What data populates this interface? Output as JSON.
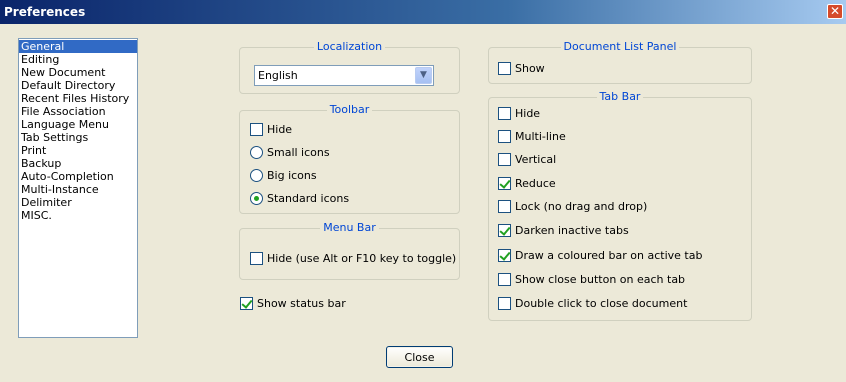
{
  "window": {
    "title": "Preferences",
    "close_glyph": "✕"
  },
  "categories": [
    {
      "label": "General",
      "selected": true
    },
    {
      "label": "Editing"
    },
    {
      "label": "New Document"
    },
    {
      "label": "Default Directory"
    },
    {
      "label": "Recent Files History"
    },
    {
      "label": "File Association"
    },
    {
      "label": "Language Menu"
    },
    {
      "label": "Tab Settings"
    },
    {
      "label": "Print"
    },
    {
      "label": "Backup"
    },
    {
      "label": "Auto-Completion"
    },
    {
      "label": "Multi-Instance"
    },
    {
      "label": "Delimiter"
    },
    {
      "label": "MISC."
    }
  ],
  "localization": {
    "title": "Localization",
    "language": "English"
  },
  "toolbar": {
    "title": "Toolbar",
    "hide": {
      "label": "Hide",
      "checked": false
    },
    "small_icons": {
      "label": "Small icons",
      "checked": false
    },
    "big_icons": {
      "label": "Big icons",
      "checked": false
    },
    "standard_icons": {
      "label": "Standard icons",
      "checked": true
    }
  },
  "menu_bar": {
    "title": "Menu Bar",
    "hide": {
      "label": "Hide (use Alt or F10 key to toggle)",
      "checked": false
    }
  },
  "status_bar": {
    "label": "Show status bar",
    "checked": true
  },
  "doc_list_panel": {
    "title": "Document List Panel",
    "show": {
      "label": "Show",
      "checked": false
    }
  },
  "tab_bar": {
    "title": "Tab Bar",
    "hide": {
      "label": "Hide",
      "checked": false
    },
    "multi_line": {
      "label": "Multi-line",
      "checked": false
    },
    "vertical": {
      "label": "Vertical",
      "checked": false
    },
    "reduce": {
      "label": "Reduce",
      "checked": true
    },
    "lock": {
      "label": "Lock (no drag and drop)",
      "checked": false
    },
    "darken": {
      "label": "Darken inactive tabs",
      "checked": true
    },
    "coloured_bar": {
      "label": "Draw a coloured bar on active tab",
      "checked": true
    },
    "close_button": {
      "label": "Show close button on each tab",
      "checked": false
    },
    "dbl_click": {
      "label": "Double click to close document",
      "checked": false
    }
  },
  "buttons": {
    "close": "Close"
  },
  "colors": {
    "accent": "#316ac5",
    "group_title": "#0046d5",
    "check_mark": "#21a121"
  }
}
